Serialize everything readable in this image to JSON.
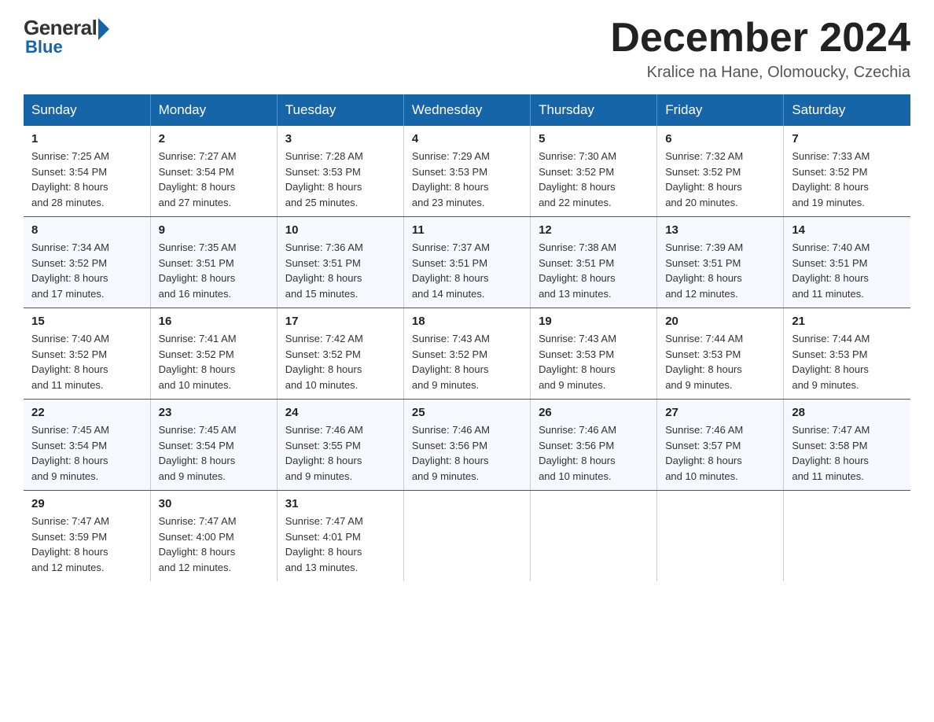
{
  "logo": {
    "general": "General",
    "blue": "Blue"
  },
  "title": "December 2024",
  "location": "Kralice na Hane, Olomoucky, Czechia",
  "days_of_week": [
    "Sunday",
    "Monday",
    "Tuesday",
    "Wednesday",
    "Thursday",
    "Friday",
    "Saturday"
  ],
  "weeks": [
    [
      {
        "day": "1",
        "sunrise": "7:25 AM",
        "sunset": "3:54 PM",
        "daylight": "8 hours and 28 minutes."
      },
      {
        "day": "2",
        "sunrise": "7:27 AM",
        "sunset": "3:54 PM",
        "daylight": "8 hours and 27 minutes."
      },
      {
        "day": "3",
        "sunrise": "7:28 AM",
        "sunset": "3:53 PM",
        "daylight": "8 hours and 25 minutes."
      },
      {
        "day": "4",
        "sunrise": "7:29 AM",
        "sunset": "3:53 PM",
        "daylight": "8 hours and 23 minutes."
      },
      {
        "day": "5",
        "sunrise": "7:30 AM",
        "sunset": "3:52 PM",
        "daylight": "8 hours and 22 minutes."
      },
      {
        "day": "6",
        "sunrise": "7:32 AM",
        "sunset": "3:52 PM",
        "daylight": "8 hours and 20 minutes."
      },
      {
        "day": "7",
        "sunrise": "7:33 AM",
        "sunset": "3:52 PM",
        "daylight": "8 hours and 19 minutes."
      }
    ],
    [
      {
        "day": "8",
        "sunrise": "7:34 AM",
        "sunset": "3:52 PM",
        "daylight": "8 hours and 17 minutes."
      },
      {
        "day": "9",
        "sunrise": "7:35 AM",
        "sunset": "3:51 PM",
        "daylight": "8 hours and 16 minutes."
      },
      {
        "day": "10",
        "sunrise": "7:36 AM",
        "sunset": "3:51 PM",
        "daylight": "8 hours and 15 minutes."
      },
      {
        "day": "11",
        "sunrise": "7:37 AM",
        "sunset": "3:51 PM",
        "daylight": "8 hours and 14 minutes."
      },
      {
        "day": "12",
        "sunrise": "7:38 AM",
        "sunset": "3:51 PM",
        "daylight": "8 hours and 13 minutes."
      },
      {
        "day": "13",
        "sunrise": "7:39 AM",
        "sunset": "3:51 PM",
        "daylight": "8 hours and 12 minutes."
      },
      {
        "day": "14",
        "sunrise": "7:40 AM",
        "sunset": "3:51 PM",
        "daylight": "8 hours and 11 minutes."
      }
    ],
    [
      {
        "day": "15",
        "sunrise": "7:40 AM",
        "sunset": "3:52 PM",
        "daylight": "8 hours and 11 minutes."
      },
      {
        "day": "16",
        "sunrise": "7:41 AM",
        "sunset": "3:52 PM",
        "daylight": "8 hours and 10 minutes."
      },
      {
        "day": "17",
        "sunrise": "7:42 AM",
        "sunset": "3:52 PM",
        "daylight": "8 hours and 10 minutes."
      },
      {
        "day": "18",
        "sunrise": "7:43 AM",
        "sunset": "3:52 PM",
        "daylight": "8 hours and 9 minutes."
      },
      {
        "day": "19",
        "sunrise": "7:43 AM",
        "sunset": "3:53 PM",
        "daylight": "8 hours and 9 minutes."
      },
      {
        "day": "20",
        "sunrise": "7:44 AM",
        "sunset": "3:53 PM",
        "daylight": "8 hours and 9 minutes."
      },
      {
        "day": "21",
        "sunrise": "7:44 AM",
        "sunset": "3:53 PM",
        "daylight": "8 hours and 9 minutes."
      }
    ],
    [
      {
        "day": "22",
        "sunrise": "7:45 AM",
        "sunset": "3:54 PM",
        "daylight": "8 hours and 9 minutes."
      },
      {
        "day": "23",
        "sunrise": "7:45 AM",
        "sunset": "3:54 PM",
        "daylight": "8 hours and 9 minutes."
      },
      {
        "day": "24",
        "sunrise": "7:46 AM",
        "sunset": "3:55 PM",
        "daylight": "8 hours and 9 minutes."
      },
      {
        "day": "25",
        "sunrise": "7:46 AM",
        "sunset": "3:56 PM",
        "daylight": "8 hours and 9 minutes."
      },
      {
        "day": "26",
        "sunrise": "7:46 AM",
        "sunset": "3:56 PM",
        "daylight": "8 hours and 10 minutes."
      },
      {
        "day": "27",
        "sunrise": "7:46 AM",
        "sunset": "3:57 PM",
        "daylight": "8 hours and 10 minutes."
      },
      {
        "day": "28",
        "sunrise": "7:47 AM",
        "sunset": "3:58 PM",
        "daylight": "8 hours and 11 minutes."
      }
    ],
    [
      {
        "day": "29",
        "sunrise": "7:47 AM",
        "sunset": "3:59 PM",
        "daylight": "8 hours and 12 minutes."
      },
      {
        "day": "30",
        "sunrise": "7:47 AM",
        "sunset": "4:00 PM",
        "daylight": "8 hours and 12 minutes."
      },
      {
        "day": "31",
        "sunrise": "7:47 AM",
        "sunset": "4:01 PM",
        "daylight": "8 hours and 13 minutes."
      },
      null,
      null,
      null,
      null
    ]
  ],
  "labels": {
    "sunrise": "Sunrise:",
    "sunset": "Sunset:",
    "daylight": "Daylight:"
  }
}
